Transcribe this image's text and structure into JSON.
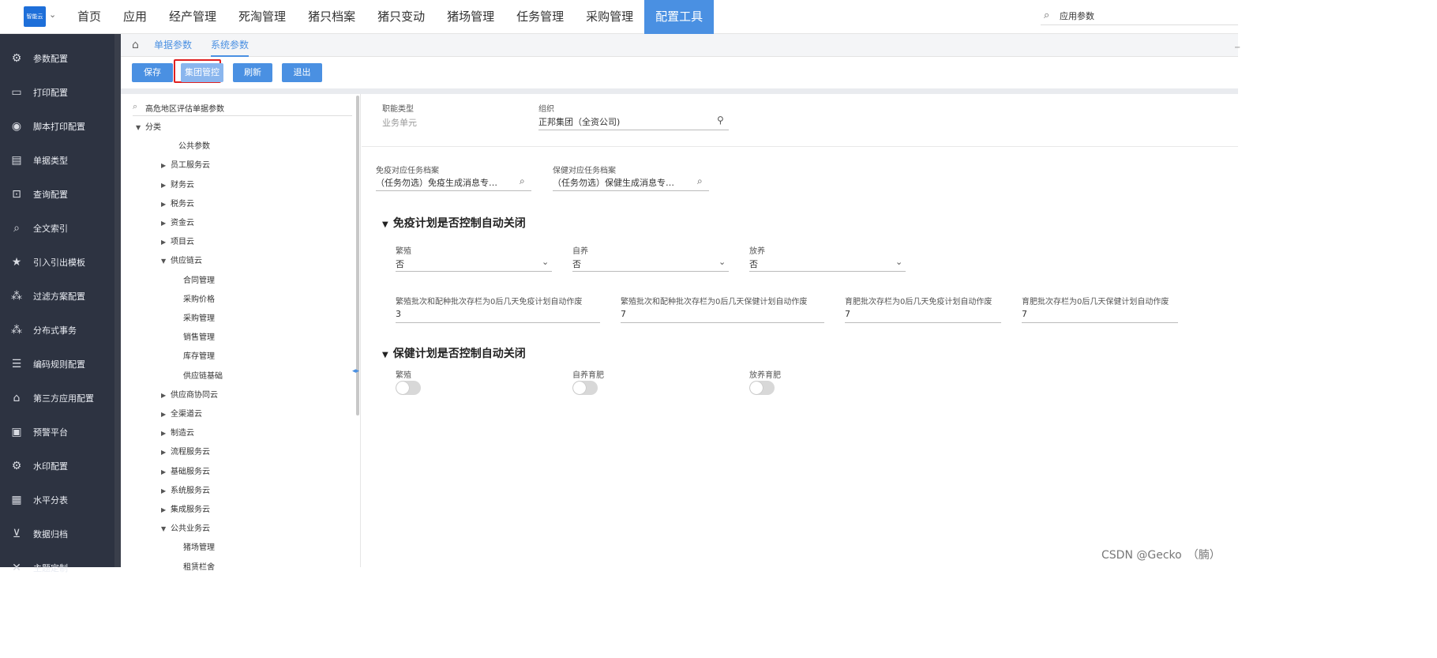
{
  "topbar": {
    "logo_text": "智能云",
    "nav": [
      "首页",
      "应用",
      "经产管理",
      "死淘管理",
      "猪只档案",
      "猪只变动",
      "猪场管理",
      "任务管理",
      "采购管理",
      "配置工具"
    ],
    "active_nav": "配置工具",
    "search_value": "应用参数"
  },
  "sidebar": {
    "items": [
      {
        "label": "参数配置",
        "icon": "gear-icon"
      },
      {
        "label": "打印配置",
        "icon": "image-icon"
      },
      {
        "label": "脚本打印配置",
        "icon": "circle-icon"
      },
      {
        "label": "单据类型",
        "icon": "folder-icon"
      },
      {
        "label": "查询配置",
        "icon": "query-icon"
      },
      {
        "label": "全文索引",
        "icon": "index-icon"
      },
      {
        "label": "引入引出模板",
        "icon": "template-icon"
      },
      {
        "label": "过滤方案配置",
        "icon": "filter-icon"
      },
      {
        "label": "分布式事务",
        "icon": "cluster-icon"
      },
      {
        "label": "编码规则配置",
        "icon": "list-icon"
      },
      {
        "label": "第三方应用配置",
        "icon": "building-icon"
      },
      {
        "label": "预警平台",
        "icon": "monitor-icon"
      },
      {
        "label": "水印配置",
        "icon": "watermark-icon"
      },
      {
        "label": "水平分表",
        "icon": "grid-icon"
      },
      {
        "label": "数据归档",
        "icon": "archive-icon"
      },
      {
        "label": "主题定制",
        "icon": "tools-icon"
      }
    ]
  },
  "tabs": {
    "items": [
      "单据参数",
      "系统参数"
    ],
    "active": "系统参数"
  },
  "toolbar": {
    "save": "保存",
    "group_control": "集团管控",
    "refresh": "刷新",
    "exit": "退出"
  },
  "tree": {
    "search_value": "高危地区评估单据参数",
    "nodes": [
      {
        "label": "分类",
        "arrow": "▼",
        "level": 0
      },
      {
        "label": "公共参数",
        "arrow": "",
        "level": 1
      },
      {
        "label": "员工服务云",
        "arrow": "▶",
        "level": 1
      },
      {
        "label": "财务云",
        "arrow": "▶",
        "level": 1
      },
      {
        "label": "税务云",
        "arrow": "▶",
        "level": 1
      },
      {
        "label": "资金云",
        "arrow": "▶",
        "level": 1
      },
      {
        "label": "项目云",
        "arrow": "▶",
        "level": 1
      },
      {
        "label": "供应链云",
        "arrow": "▼",
        "level": 1
      },
      {
        "label": "合同管理",
        "arrow": "",
        "level": 2
      },
      {
        "label": "采购价格",
        "arrow": "",
        "level": 2
      },
      {
        "label": "采购管理",
        "arrow": "",
        "level": 2
      },
      {
        "label": "销售管理",
        "arrow": "",
        "level": 2
      },
      {
        "label": "库存管理",
        "arrow": "",
        "level": 2
      },
      {
        "label": "供应链基础",
        "arrow": "",
        "level": 2
      },
      {
        "label": "供应商协同云",
        "arrow": "▶",
        "level": 1
      },
      {
        "label": "全渠道云",
        "arrow": "▶",
        "level": 1
      },
      {
        "label": "制造云",
        "arrow": "▶",
        "level": 1
      },
      {
        "label": "流程服务云",
        "arrow": "▶",
        "level": 1
      },
      {
        "label": "基础服务云",
        "arrow": "▶",
        "level": 1
      },
      {
        "label": "系统服务云",
        "arrow": "▶",
        "level": 1
      },
      {
        "label": "集成服务云",
        "arrow": "▶",
        "level": 1
      },
      {
        "label": "公共业务云",
        "arrow": "▼",
        "level": 1
      },
      {
        "label": "猪场管理",
        "arrow": "",
        "level": 2
      },
      {
        "label": "租赁栏舍",
        "arrow": "",
        "level": 2
      }
    ]
  },
  "header_fields": {
    "func_type_label": "职能类型",
    "func_type_value": "业务单元",
    "org_label": "组织",
    "org_value": "正邦集团（全资公司)"
  },
  "task_fields": {
    "vaccine_label": "免疫对应任务档案",
    "vaccine_value": "（任务勿选）免疫生成消息专…",
    "health_label": "保健对应任务档案",
    "health_value": "（任务勿选）保健生成消息专…"
  },
  "section1": {
    "title": "免疫计划是否控制自动关闭",
    "selects": [
      {
        "label": "繁殖",
        "value": "否"
      },
      {
        "label": "自养",
        "value": "否"
      },
      {
        "label": "放养",
        "value": "否"
      }
    ],
    "numbers": [
      {
        "label": "繁殖批次和配种批次存栏为0后几天免疫计划自动作废",
        "value": "3"
      },
      {
        "label": "繁殖批次和配种批次存栏为0后几天保健计划自动作废",
        "value": "7"
      },
      {
        "label": "育肥批次存栏为0后几天免疫计划自动作废",
        "value": "7"
      },
      {
        "label": "育肥批次存栏为0后几天保健计划自动作废",
        "value": "7"
      }
    ]
  },
  "section2": {
    "title": "保健计划是否控制自动关闭",
    "toggles": [
      {
        "label": "繁殖",
        "on": false
      },
      {
        "label": "自养育肥",
        "on": false
      },
      {
        "label": "放养育肥",
        "on": false
      }
    ]
  },
  "watermark": "CSDN @Gecko　（腩）",
  "colors": {
    "accent": "#4a90e2",
    "sidebar_bg": "#2d3341",
    "highlight_border": "#e02020"
  }
}
